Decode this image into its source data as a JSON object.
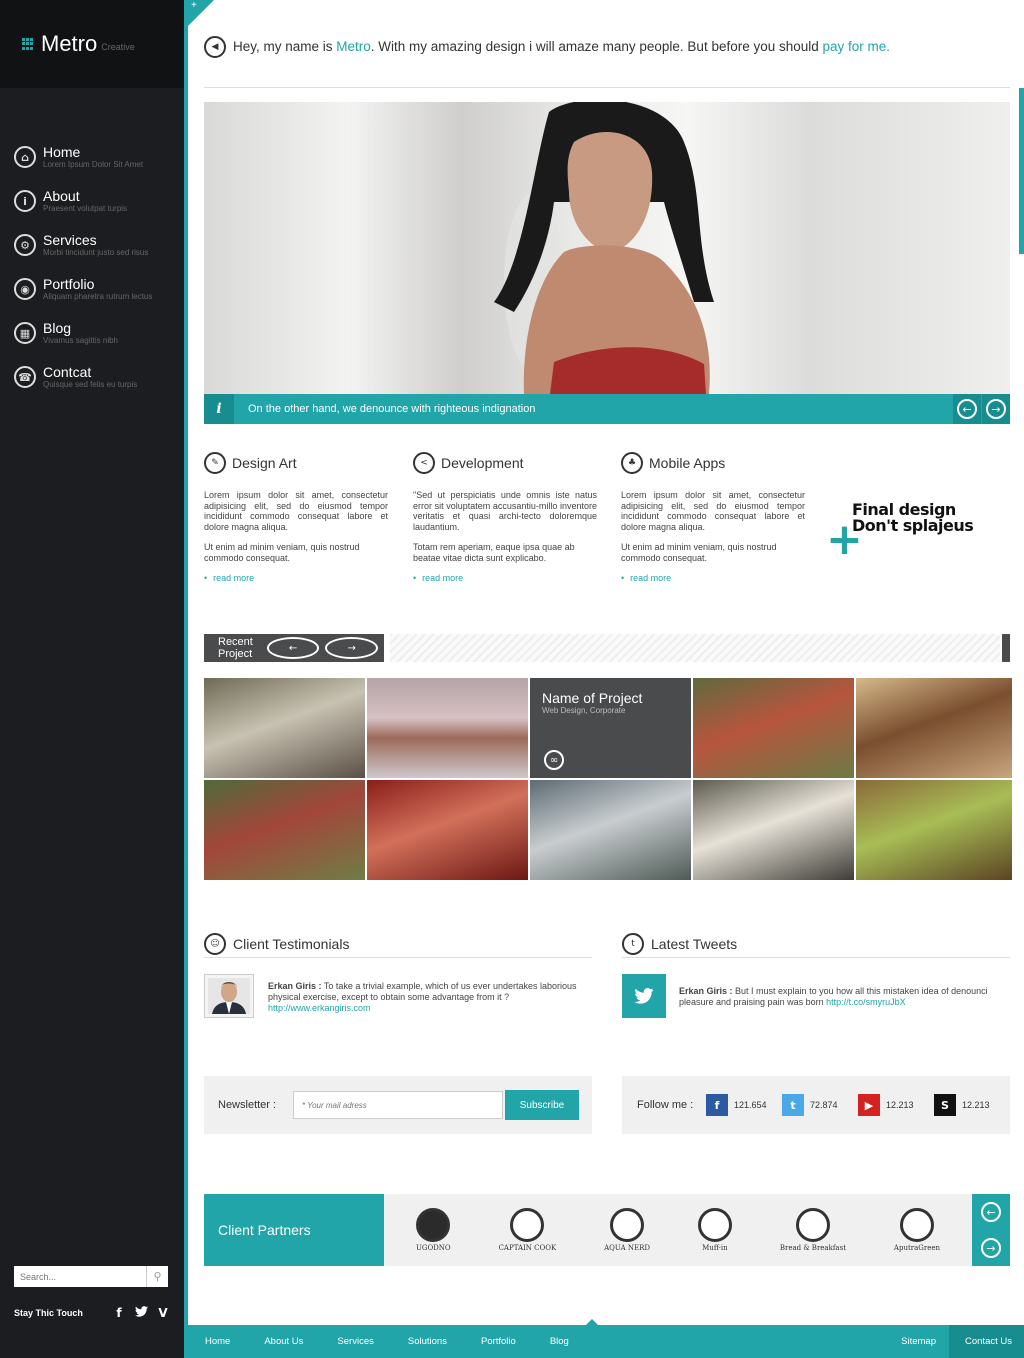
{
  "brand": {
    "name": "Metro",
    "sub": "Creative"
  },
  "nav": [
    {
      "title": "Home",
      "sub": "Lorem Ipsum Dolor Sit Amet",
      "icon": "home-icon",
      "glyph": "⌂"
    },
    {
      "title": "About",
      "sub": "Praesent volutpat turpis",
      "icon": "info-icon",
      "glyph": "i"
    },
    {
      "title": "Services",
      "sub": "Morbi tincidunt justo sed risus",
      "icon": "gears-icon",
      "glyph": "⚙"
    },
    {
      "title": "Portfolio",
      "sub": "Aliquam pharetra rutrum lectus",
      "icon": "camera-icon",
      "glyph": "◉"
    },
    {
      "title": "Blog",
      "sub": "Vivamus sagittis nibh",
      "icon": "grid-icon",
      "glyph": "▦"
    },
    {
      "title": "Contcat",
      "sub": "Quisque sed felis eu turpis",
      "icon": "phone-icon",
      "glyph": "☎"
    }
  ],
  "search": {
    "placeholder": "Search..."
  },
  "stay": {
    "label": "Stay Thic Touch"
  },
  "intro": {
    "before": "Hey, my name is ",
    "name": "Metro",
    "middle": ". With my amazing design i will amaze many people. But before you should ",
    "link": "pay for me."
  },
  "hero": {
    "caption": "On the other hand, we denounce with righteous indignation"
  },
  "services": [
    {
      "title": "Design Art",
      "icon": "pencil-icon",
      "glyph": "✎",
      "p1": "Lorem ipsum dolor sit amet, consectetur adipisicing elit, sed do eiusmod tempor incididunt commodo consequat labore et dolore magna aliqua.",
      "p2": "Ut enim ad minim veniam, quis nostrud commodo consequat.",
      "more": "read more"
    },
    {
      "title": "Development",
      "icon": "share-icon",
      "glyph": "<",
      "p1": "\"Sed ut perspiciatis unde omnis iste natus error sit voluptatem accusantiu-millo inventore veritatis et quasi archi-tecto doloremque laudantium.",
      "p2": "Totam rem aperiam, eaque ipsa quae ab beatae vitae dicta sunt explicabo.",
      "more": "read more"
    },
    {
      "title": "Mobile Apps",
      "icon": "android-icon",
      "glyph": "♣",
      "p1": "Lorem ipsum dolor sit amet, consectetur adipisicing elit, sed do eiusmod tempor incididunt commodo consequat labore et dolore magna aliqua.",
      "p2": "Ut enim ad minim veniam, quis nostrud commodo consequat.",
      "more": "read more"
    }
  ],
  "final": {
    "line1": "Final design",
    "line2": "Don't splajeus"
  },
  "recent": {
    "label": "Recent Project"
  },
  "featured": {
    "name": "Name of Project",
    "sub": "Web Design, Corporate"
  },
  "testimonials": {
    "title": "Client Testimonials",
    "author": "Erkan Giris :",
    "text": " To take a trivial example, which of us ever undertakes laborious physical exercise, except to obtain some advantage from it ?",
    "link": "http://www.erkangiris.com"
  },
  "tweets": {
    "title": "Latest Tweets",
    "author": "Erkan Giris :",
    "text": " But I must explain to you how all this mistaken idea of denounci pleasure and praising pain was born ",
    "link": "http://t.co/smyruJbX"
  },
  "newsletter": {
    "label": "Newsletter :",
    "placeholder": "* Your mail adress",
    "button": "Subscribe"
  },
  "follow": {
    "label": "Follow me :",
    "items": [
      {
        "net": "facebook",
        "glyph": "f",
        "color": "#2c5aa0",
        "count": "121.654"
      },
      {
        "net": "twitter",
        "glyph": "t",
        "color": "#4aa8e6",
        "count": "72.874"
      },
      {
        "net": "youtube",
        "glyph": "▶",
        "color": "#d42222",
        "count": "12.213"
      },
      {
        "net": "skype",
        "glyph": "S",
        "color": "#111111",
        "count": "12.213"
      }
    ]
  },
  "partners": {
    "title": "Client Partners",
    "logos": [
      "UGODNO",
      "CAPTAIN COOK",
      "AQUA NERD",
      "Muff-in",
      "Bread & Breakfast",
      "AputraGreen"
    ]
  },
  "footer": {
    "links": [
      "Home",
      "About Us",
      "Services",
      "Solutions",
      "Portfolio",
      "Blog"
    ],
    "sitemap": "Sitemap",
    "contact": "Contact Us"
  },
  "colors": {
    "accent": "#21a5a8",
    "sidebar": "#1c1d20",
    "dark_panel": "#4a4b4d"
  }
}
